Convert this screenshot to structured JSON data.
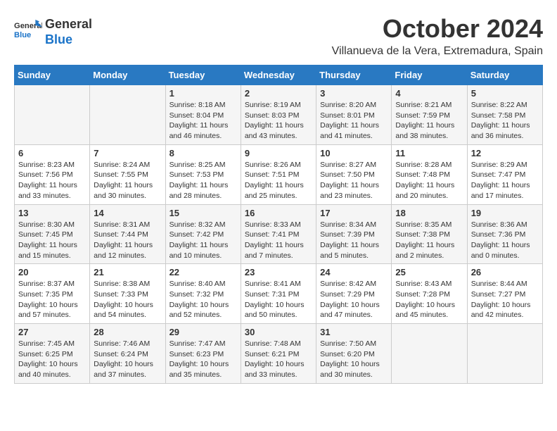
{
  "logo": {
    "line1": "General",
    "line2": "Blue"
  },
  "title": "October 2024",
  "location": "Villanueva de la Vera, Extremadura, Spain",
  "weekdays": [
    "Sunday",
    "Monday",
    "Tuesday",
    "Wednesday",
    "Thursday",
    "Friday",
    "Saturday"
  ],
  "weeks": [
    [
      {
        "day": "",
        "info": ""
      },
      {
        "day": "",
        "info": ""
      },
      {
        "day": "1",
        "info": "Sunrise: 8:18 AM\nSunset: 8:04 PM\nDaylight: 11 hours and 46 minutes."
      },
      {
        "day": "2",
        "info": "Sunrise: 8:19 AM\nSunset: 8:03 PM\nDaylight: 11 hours and 43 minutes."
      },
      {
        "day": "3",
        "info": "Sunrise: 8:20 AM\nSunset: 8:01 PM\nDaylight: 11 hours and 41 minutes."
      },
      {
        "day": "4",
        "info": "Sunrise: 8:21 AM\nSunset: 7:59 PM\nDaylight: 11 hours and 38 minutes."
      },
      {
        "day": "5",
        "info": "Sunrise: 8:22 AM\nSunset: 7:58 PM\nDaylight: 11 hours and 36 minutes."
      }
    ],
    [
      {
        "day": "6",
        "info": "Sunrise: 8:23 AM\nSunset: 7:56 PM\nDaylight: 11 hours and 33 minutes."
      },
      {
        "day": "7",
        "info": "Sunrise: 8:24 AM\nSunset: 7:55 PM\nDaylight: 11 hours and 30 minutes."
      },
      {
        "day": "8",
        "info": "Sunrise: 8:25 AM\nSunset: 7:53 PM\nDaylight: 11 hours and 28 minutes."
      },
      {
        "day": "9",
        "info": "Sunrise: 8:26 AM\nSunset: 7:51 PM\nDaylight: 11 hours and 25 minutes."
      },
      {
        "day": "10",
        "info": "Sunrise: 8:27 AM\nSunset: 7:50 PM\nDaylight: 11 hours and 23 minutes."
      },
      {
        "day": "11",
        "info": "Sunrise: 8:28 AM\nSunset: 7:48 PM\nDaylight: 11 hours and 20 minutes."
      },
      {
        "day": "12",
        "info": "Sunrise: 8:29 AM\nSunset: 7:47 PM\nDaylight: 11 hours and 17 minutes."
      }
    ],
    [
      {
        "day": "13",
        "info": "Sunrise: 8:30 AM\nSunset: 7:45 PM\nDaylight: 11 hours and 15 minutes."
      },
      {
        "day": "14",
        "info": "Sunrise: 8:31 AM\nSunset: 7:44 PM\nDaylight: 11 hours and 12 minutes."
      },
      {
        "day": "15",
        "info": "Sunrise: 8:32 AM\nSunset: 7:42 PM\nDaylight: 11 hours and 10 minutes."
      },
      {
        "day": "16",
        "info": "Sunrise: 8:33 AM\nSunset: 7:41 PM\nDaylight: 11 hours and 7 minutes."
      },
      {
        "day": "17",
        "info": "Sunrise: 8:34 AM\nSunset: 7:39 PM\nDaylight: 11 hours and 5 minutes."
      },
      {
        "day": "18",
        "info": "Sunrise: 8:35 AM\nSunset: 7:38 PM\nDaylight: 11 hours and 2 minutes."
      },
      {
        "day": "19",
        "info": "Sunrise: 8:36 AM\nSunset: 7:36 PM\nDaylight: 11 hours and 0 minutes."
      }
    ],
    [
      {
        "day": "20",
        "info": "Sunrise: 8:37 AM\nSunset: 7:35 PM\nDaylight: 10 hours and 57 minutes."
      },
      {
        "day": "21",
        "info": "Sunrise: 8:38 AM\nSunset: 7:33 PM\nDaylight: 10 hours and 54 minutes."
      },
      {
        "day": "22",
        "info": "Sunrise: 8:40 AM\nSunset: 7:32 PM\nDaylight: 10 hours and 52 minutes."
      },
      {
        "day": "23",
        "info": "Sunrise: 8:41 AM\nSunset: 7:31 PM\nDaylight: 10 hours and 50 minutes."
      },
      {
        "day": "24",
        "info": "Sunrise: 8:42 AM\nSunset: 7:29 PM\nDaylight: 10 hours and 47 minutes."
      },
      {
        "day": "25",
        "info": "Sunrise: 8:43 AM\nSunset: 7:28 PM\nDaylight: 10 hours and 45 minutes."
      },
      {
        "day": "26",
        "info": "Sunrise: 8:44 AM\nSunset: 7:27 PM\nDaylight: 10 hours and 42 minutes."
      }
    ],
    [
      {
        "day": "27",
        "info": "Sunrise: 7:45 AM\nSunset: 6:25 PM\nDaylight: 10 hours and 40 minutes."
      },
      {
        "day": "28",
        "info": "Sunrise: 7:46 AM\nSunset: 6:24 PM\nDaylight: 10 hours and 37 minutes."
      },
      {
        "day": "29",
        "info": "Sunrise: 7:47 AM\nSunset: 6:23 PM\nDaylight: 10 hours and 35 minutes."
      },
      {
        "day": "30",
        "info": "Sunrise: 7:48 AM\nSunset: 6:21 PM\nDaylight: 10 hours and 33 minutes."
      },
      {
        "day": "31",
        "info": "Sunrise: 7:50 AM\nSunset: 6:20 PM\nDaylight: 10 hours and 30 minutes."
      },
      {
        "day": "",
        "info": ""
      },
      {
        "day": "",
        "info": ""
      }
    ]
  ]
}
